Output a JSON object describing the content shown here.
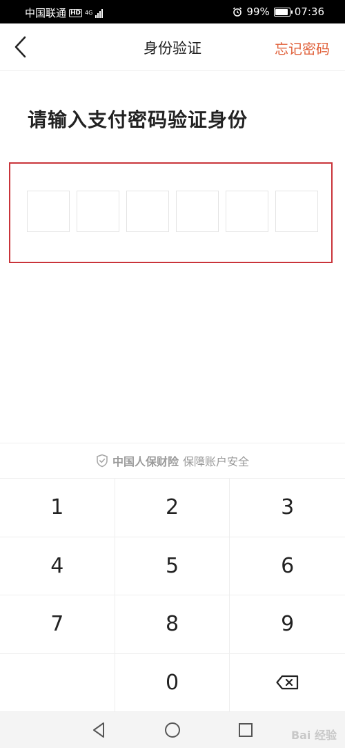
{
  "status_bar": {
    "carrier": "中国联通",
    "hd_badge": "HD",
    "network": "4G",
    "battery": "99%",
    "battery_level": 0.99,
    "time": "07:36",
    "icons": [
      "alarm-icon",
      "battery-icon",
      "signal-icon"
    ]
  },
  "nav": {
    "title": "身份验证",
    "forgot_password": "忘记密码",
    "back_icon": "chevron-left-icon"
  },
  "prompt": "请输入支付密码验证身份",
  "pin": {
    "length": 6,
    "entered": 0
  },
  "security": {
    "brand": "中国人保财险",
    "text": "保障账户安全",
    "icon": "shield-check-icon"
  },
  "keypad": {
    "keys": [
      "1",
      "2",
      "3",
      "4",
      "5",
      "6",
      "7",
      "8",
      "9",
      "",
      "0",
      "delete"
    ]
  },
  "system_nav": {
    "icons": [
      "back-triangle-icon",
      "home-circle-icon",
      "recents-square-icon"
    ]
  },
  "watermark": "Bai 经验"
}
